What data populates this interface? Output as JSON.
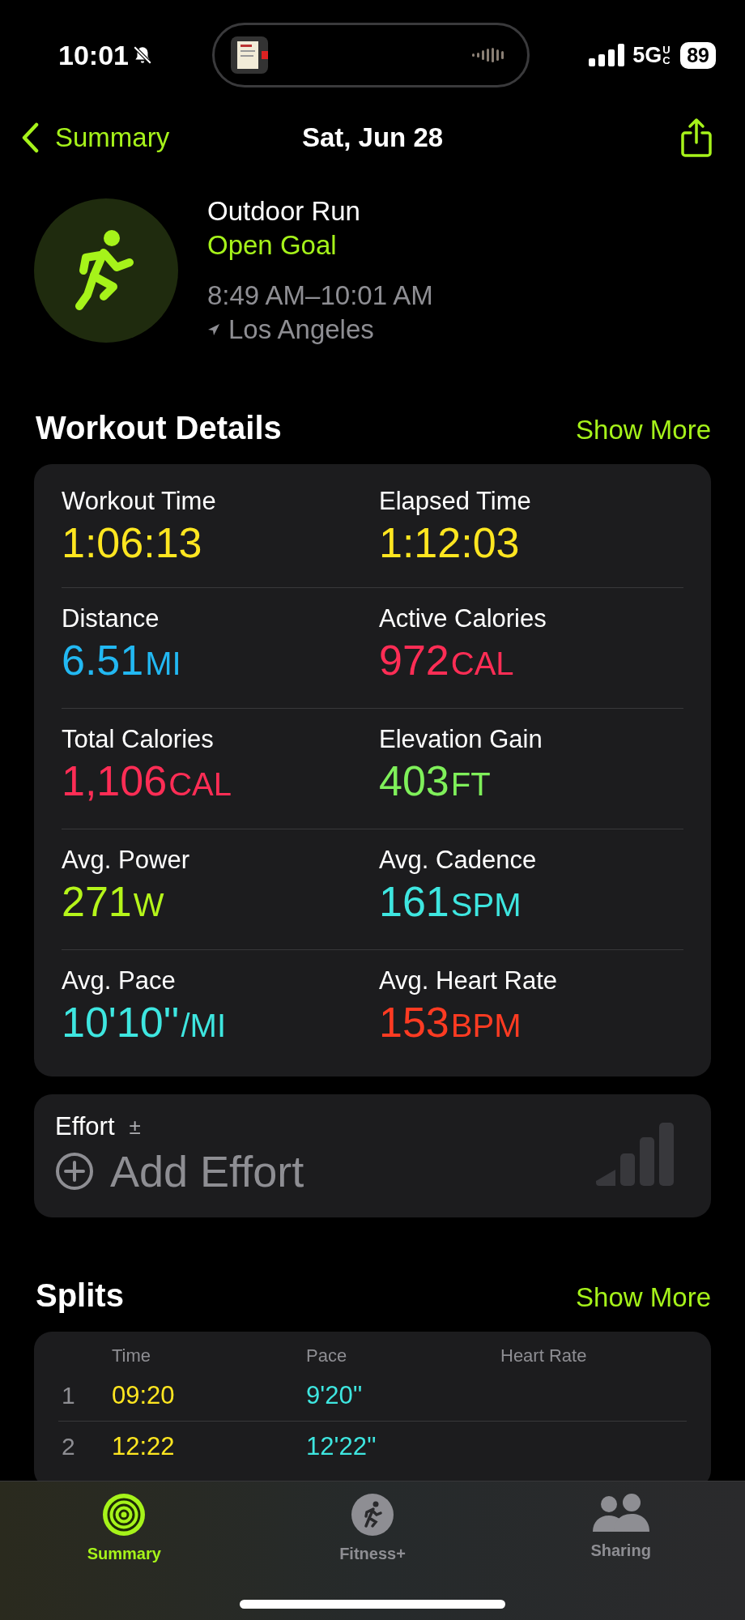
{
  "status_bar": {
    "time": "10:01",
    "network": "5G",
    "network_sub": "UC",
    "battery": "89"
  },
  "nav": {
    "back": "Summary",
    "title": "Sat, Jun 28"
  },
  "workout": {
    "name": "Outdoor Run",
    "goal": "Open Goal",
    "time_range": "8:49 AM–10:01 AM",
    "location": "Los Angeles"
  },
  "details": {
    "title": "Workout Details",
    "action": "Show More",
    "metrics": [
      {
        "label": "Workout Time",
        "value": "1:06:13",
        "color": "#ffe620"
      },
      {
        "label": "Elapsed Time",
        "value": "1:12:03",
        "color": "#ffe620"
      },
      {
        "label": "Distance",
        "value": "6.51",
        "unit": "MI",
        "color": "#22b8f2"
      },
      {
        "label": "Active Calories",
        "value": "972",
        "unit": "CAL",
        "color": "#ff2d55"
      },
      {
        "label": "Total Calories",
        "value": "1,106",
        "unit": "CAL",
        "color": "#ff2d55"
      },
      {
        "label": "Elevation Gain",
        "value": "403",
        "unit": "FT",
        "color": "#7ff05a"
      },
      {
        "label": "Avg. Power",
        "value": "271",
        "unit": "W",
        "color": "#b5f51a"
      },
      {
        "label": "Avg. Cadence",
        "value": "161",
        "unit": "SPM",
        "color": "#3ee6e0"
      },
      {
        "label": "Avg. Pace",
        "value": "10'10''",
        "unit": "/MI",
        "color": "#3ee6e0"
      },
      {
        "label": "Avg. Heart Rate",
        "value": "153",
        "unit": "BPM",
        "color": "#ff3b22"
      }
    ]
  },
  "effort": {
    "label": "Effort",
    "sign": "±",
    "action": "Add Effort"
  },
  "splits": {
    "title": "Splits",
    "action": "Show More",
    "columns": [
      "Time",
      "Pace",
      "Heart Rate"
    ],
    "rows": [
      {
        "index": "1",
        "time": "09:20",
        "pace": "9'20''"
      },
      {
        "index": "2",
        "time": "12:22",
        "pace": "12'22''"
      }
    ]
  },
  "tabs": [
    {
      "label": "Summary",
      "selected": true,
      "kind": "rings"
    },
    {
      "label": "Fitness+",
      "selected": false,
      "kind": "runner"
    },
    {
      "label": "Sharing",
      "selected": false,
      "kind": "people"
    }
  ]
}
